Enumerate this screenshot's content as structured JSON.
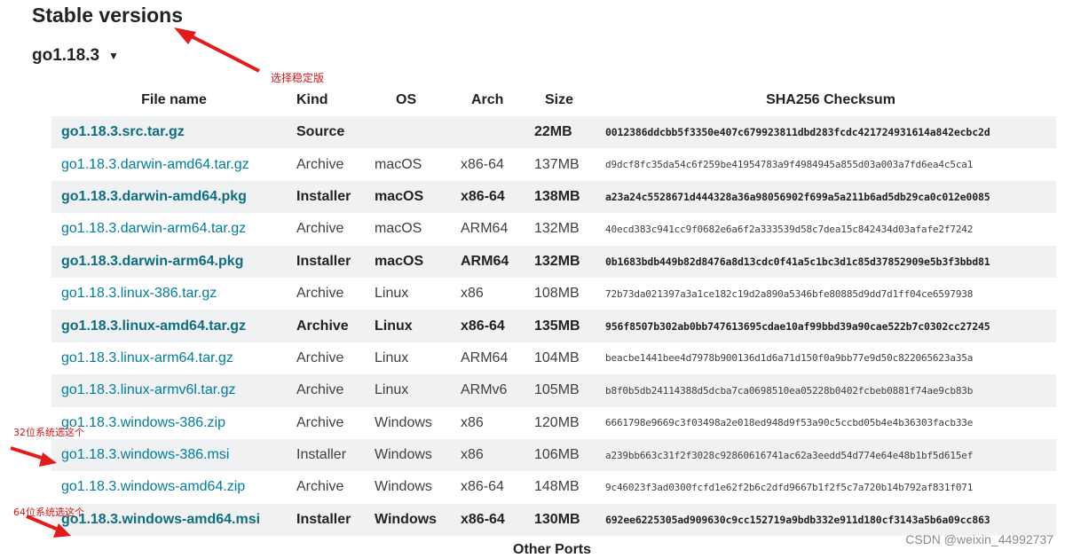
{
  "title": "Stable versions",
  "version_selector": {
    "label": "go1.18.3",
    "caret": "▼"
  },
  "annotations": {
    "stable": "选择稳定版",
    "bit32": "32位系统选这个",
    "bit64": "64位系统选这个"
  },
  "table": {
    "headers": {
      "filename": "File name",
      "kind": "Kind",
      "os": "OS",
      "arch": "Arch",
      "size": "Size",
      "sha": "SHA256 Checksum"
    },
    "rows": [
      {
        "filename": "go1.18.3.src.tar.gz",
        "kind": "Source",
        "os": "",
        "arch": "",
        "size": "22MB",
        "sha": "0012386ddcbb5f3350e407c679923811dbd283fcdc421724931614a842ecbc2d",
        "featured": true
      },
      {
        "filename": "go1.18.3.darwin-amd64.tar.gz",
        "kind": "Archive",
        "os": "macOS",
        "arch": "x86-64",
        "size": "137MB",
        "sha": "d9dcf8fc35da54c6f259be41954783a9f4984945a855d03a003a7fd6ea4c5ca1",
        "featured": false
      },
      {
        "filename": "go1.18.3.darwin-amd64.pkg",
        "kind": "Installer",
        "os": "macOS",
        "arch": "x86-64",
        "size": "138MB",
        "sha": "a23a24c5528671d444328a36a98056902f699a5a211b6ad5db29ca0c012e0085",
        "featured": true
      },
      {
        "filename": "go1.18.3.darwin-arm64.tar.gz",
        "kind": "Archive",
        "os": "macOS",
        "arch": "ARM64",
        "size": "132MB",
        "sha": "40ecd383c941cc9f0682e6a6f2a333539d58c7dea15c842434d03afafe2f7242",
        "featured": false
      },
      {
        "filename": "go1.18.3.darwin-arm64.pkg",
        "kind": "Installer",
        "os": "macOS",
        "arch": "ARM64",
        "size": "132MB",
        "sha": "0b1683bdb449b82d8476a8d13cdc0f41a5c1bc3d1c85d37852909e5b3f3bbd81",
        "featured": true
      },
      {
        "filename": "go1.18.3.linux-386.tar.gz",
        "kind": "Archive",
        "os": "Linux",
        "arch": "x86",
        "size": "108MB",
        "sha": "72b73da021397a3a1ce182c19d2a890a5346bfe80885d9dd7d1ff04ce6597938",
        "featured": false
      },
      {
        "filename": "go1.18.3.linux-amd64.tar.gz",
        "kind": "Archive",
        "os": "Linux",
        "arch": "x86-64",
        "size": "135MB",
        "sha": "956f8507b302ab0bb747613695cdae10af99bbd39a90cae522b7c0302cc27245",
        "featured": true
      },
      {
        "filename": "go1.18.3.linux-arm64.tar.gz",
        "kind": "Archive",
        "os": "Linux",
        "arch": "ARM64",
        "size": "104MB",
        "sha": "beacbe1441bee4d7978b900136d1d6a71d150f0a9bb77e9d50c822065623a35a",
        "featured": false
      },
      {
        "filename": "go1.18.3.linux-armv6l.tar.gz",
        "kind": "Archive",
        "os": "Linux",
        "arch": "ARMv6",
        "size": "105MB",
        "sha": "b8f0b5db24114388d5dcba7ca0698510ea05228b0402fcbeb0881f74ae9cb83b",
        "featured": false
      },
      {
        "filename": "go1.18.3.windows-386.zip",
        "kind": "Archive",
        "os": "Windows",
        "arch": "x86",
        "size": "120MB",
        "sha": "6661798e9669c3f03498a2e018ed948d9f53a90c5ccbd05b4e4b36303facb33e",
        "featured": false
      },
      {
        "filename": "go1.18.3.windows-386.msi",
        "kind": "Installer",
        "os": "Windows",
        "arch": "x86",
        "size": "106MB",
        "sha": "a239bb663c31f2f3028c92860616741ac62a3eedd54d774e64e48b1bf5d615ef",
        "featured": false
      },
      {
        "filename": "go1.18.3.windows-amd64.zip",
        "kind": "Archive",
        "os": "Windows",
        "arch": "x86-64",
        "size": "148MB",
        "sha": "9c46023f3ad0300fcfd1e62f2b6c2dfd9667b1f2f5c7a720b14b792af831f071",
        "featured": false
      },
      {
        "filename": "go1.18.3.windows-amd64.msi",
        "kind": "Installer",
        "os": "Windows",
        "arch": "x86-64",
        "size": "130MB",
        "sha": "692ee6225305ad909630c9cc152719a9bdb332e911d180cf3143a5b6a09cc863",
        "featured": true
      }
    ]
  },
  "other_ports": "Other Ports",
  "watermark": "CSDN @weixin_44992737",
  "colors": {
    "link": "#007d9c",
    "stripe": "#f0f1f2",
    "annotation": "#d51515"
  }
}
